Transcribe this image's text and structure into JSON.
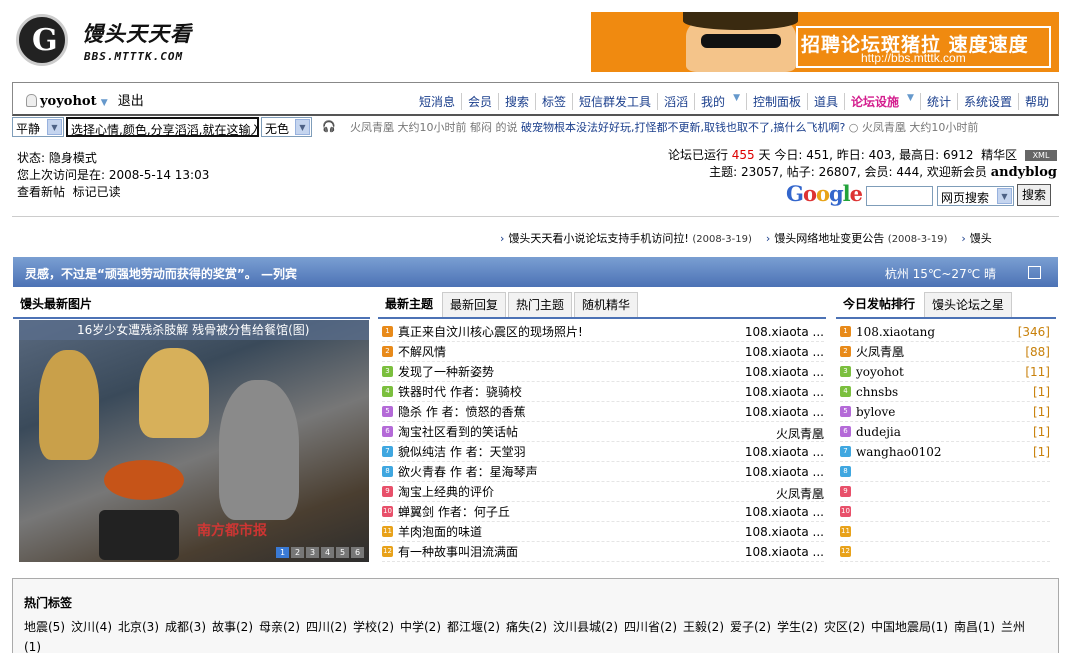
{
  "site": {
    "logo_text": "馒头天天看",
    "logo_url_text": "BBS.MTTTK.COM",
    "banner_title": "招聘论坛斑猪拉 速度速度",
    "banner_url": "http://bbs.mtttk.com"
  },
  "user": {
    "name": "yoyohot",
    "logout": "退出"
  },
  "nav": [
    "短消息",
    "会员",
    "搜索",
    "标签",
    "短信群发工具",
    "滔滔",
    "我的",
    "控制面板",
    "道具",
    "论坛设施",
    "统计",
    "系统设置",
    "帮助"
  ],
  "toolbar": {
    "mood": "平静",
    "mood_input": "选择心情,颜色,分享滔滔,就在这输入",
    "color": "无色",
    "ticker": [
      {
        "text": "火凤青凰  大约10小时前  郁闷  的说  ",
        "bold": false
      },
      {
        "text": "破宠物根本没法好好玩,打怪都不更新,取钱也取不了,搞什么飞机啊?",
        "bold": true
      },
      {
        "text": "   火凤青凰  大约10小时前",
        "bold": false
      }
    ]
  },
  "status": {
    "line1": "状态: 隐身模式",
    "line2": "您上次访问是在: 2008-5-14 13:03",
    "view_new": "查看新帖",
    "mark_read": "标记已读"
  },
  "stats": {
    "running_label": "论坛已运行",
    "days": "455",
    "days_rest": "天  今日: 451, 昨日: 403, 最高日: 6912",
    "digest": "精华区",
    "xml": "XML",
    "line2": "主题: 23057, 帖子: 26807, 会员: 444, 欢迎新会员",
    "newest_member": "andyblog"
  },
  "google": {
    "logo": "Google",
    "scope": "网页搜索",
    "button": "搜索"
  },
  "news": [
    {
      "title": "馒头天天看小说论坛支持手机访问拉!",
      "date": "(2008-3-19)"
    },
    {
      "title": "馒头网络地址变更公告",
      "date": "(2008-3-19)"
    },
    {
      "title": "馒头",
      "date": ""
    }
  ],
  "quote": {
    "text": "灵感，不过是“顽强地劳动而获得的奖赏”。   —列宾",
    "weather": "杭州  15℃~27℃  晴"
  },
  "pic_panel": {
    "tab": "馒头最新图片",
    "caption": "16岁少女遭残杀肢解 残骨被分售给餐馆(图)",
    "watermark": "南方都市报",
    "pages": [
      "1",
      "2",
      "3",
      "4",
      "5",
      "6"
    ]
  },
  "topics": {
    "tabs": [
      "最新主题",
      "最新回复",
      "热门主题",
      "随机精华"
    ],
    "items": [
      {
        "title": "真正来自汶川核心震区的现场照片!",
        "author": "108.xiaota ..."
      },
      {
        "title": "不解风情",
        "author": "108.xiaota ..."
      },
      {
        "title": "发现了一种新姿势",
        "author": "108.xiaota ..."
      },
      {
        "title": "铁器时代  作者：骁骑校",
        "author": "108.xiaota ..."
      },
      {
        "title": "隐杀  作  者：愤怒的香蕉",
        "author": "108.xiaota ..."
      },
      {
        "title": "淘宝社区看到的笑话帖",
        "author": "火凤青凰"
      },
      {
        "title": "貌似纯洁  作  者：天堂羽",
        "author": "108.xiaota ..."
      },
      {
        "title": "欲火青春  作  者：星海琴声",
        "author": "108.xiaota ..."
      },
      {
        "title": "淘宝上经典的评价",
        "author": "火凤青凰"
      },
      {
        "title": "蝉翼剑  作者：何子丘",
        "author": "108.xiaota ..."
      },
      {
        "title": "羊肉泡面的味道",
        "author": "108.xiaota ..."
      },
      {
        "title": "有一种故事叫泪流满面",
        "author": "108.xiaota ..."
      }
    ]
  },
  "ranking": {
    "tabs": [
      "今日发帖排行",
      "馒头论坛之星"
    ],
    "items": [
      {
        "name": "108.xiaotang",
        "count": "[346]"
      },
      {
        "name": "火凤青凰",
        "count": "[88]"
      },
      {
        "name": "yoyohot",
        "count": "[11]"
      },
      {
        "name": "chnsbs",
        "count": "[1]"
      },
      {
        "name": "bylove",
        "count": "[1]"
      },
      {
        "name": "dudejia",
        "count": "[1]"
      },
      {
        "name": "wanghao0102",
        "count": "[1]"
      },
      {
        "name": "",
        "count": ""
      },
      {
        "name": "",
        "count": ""
      },
      {
        "name": "",
        "count": ""
      },
      {
        "name": "",
        "count": ""
      },
      {
        "name": "",
        "count": ""
      }
    ]
  },
  "num_colors": [
    "#e88a1a",
    "#e88a1a",
    "#7bbf3e",
    "#7bbf3e",
    "#b46ad8",
    "#b46ad8",
    "#3fa7e0",
    "#3fa7e0",
    "#e8506a",
    "#e8506a",
    "#e8a21a",
    "#e8a21a"
  ],
  "hot_tags": {
    "title": "热门标签",
    "tags": [
      "地震(5)",
      "汶川(4)",
      "北京(3)",
      "成都(3)",
      "故事(2)",
      "母亲(2)",
      "四川(2)",
      "学校(2)",
      "中学(2)",
      "都江堰(2)",
      "痛失(2)",
      "汶川县城(2)",
      "四川省(2)",
      "王毅(2)",
      "爱子(2)",
      "学生(2)",
      "灾区(2)",
      "中国地震局(1)",
      "南昌(1)",
      "兰州(1)"
    ]
  }
}
